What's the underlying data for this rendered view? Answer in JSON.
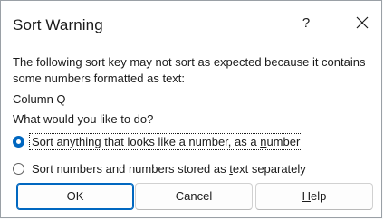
{
  "dialog": {
    "title": "Sort Warning",
    "help_glyph": "?",
    "close_icon": "close-icon"
  },
  "message": {
    "text": "The following sort key may not sort as expected because it contains some numbers formatted as text:",
    "column": "Column Q",
    "question": "What would you like to do?"
  },
  "options": [
    {
      "label_before": "Sort anything that looks like a number, as a ",
      "label_accel": "n",
      "label_after": "umber",
      "selected": true
    },
    {
      "label_before": "Sort numbers and numbers stored as ",
      "label_accel": "t",
      "label_after": "ext separately",
      "selected": false
    }
  ],
  "buttons": {
    "ok": "OK",
    "cancel": "Cancel",
    "help_accel": "H",
    "help_rest": "elp"
  },
  "colors": {
    "accent": "#0067c0",
    "text": "#1b1b1b",
    "border": "#d1d1d1"
  }
}
